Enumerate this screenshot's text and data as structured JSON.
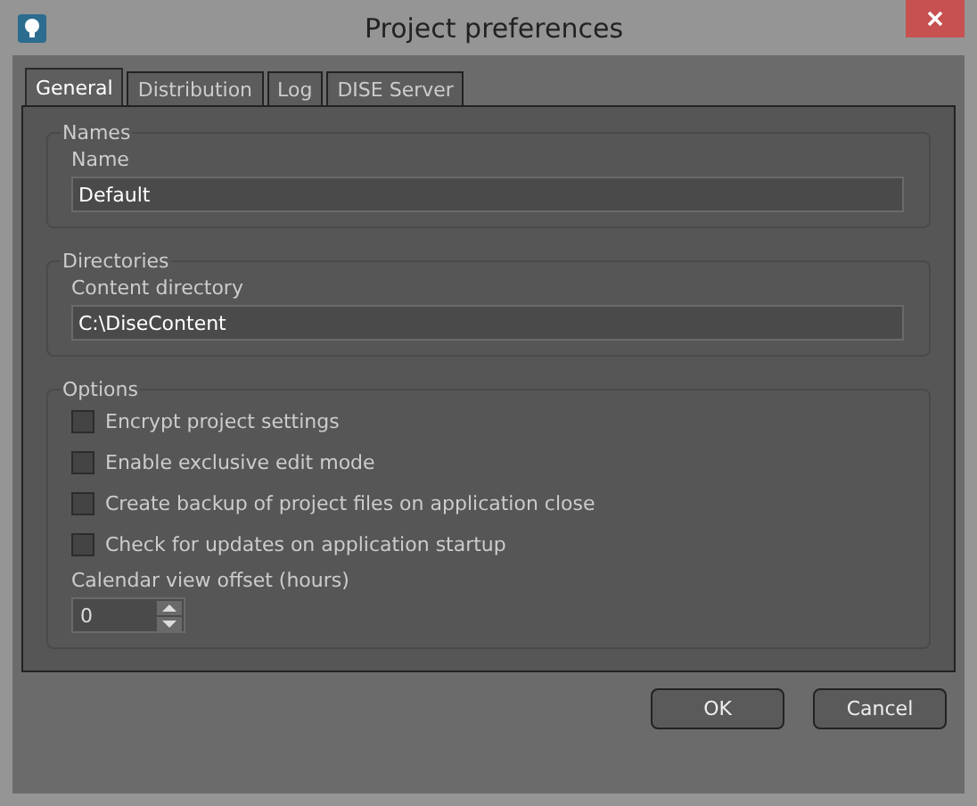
{
  "window": {
    "title": "Project preferences"
  },
  "tabs": [
    {
      "label": "General",
      "selected": true
    },
    {
      "label": "Distribution",
      "selected": false
    },
    {
      "label": "Log",
      "selected": false
    },
    {
      "label": "DISE Server",
      "selected": false
    }
  ],
  "groups": [
    {
      "title": "Names",
      "fields": [
        {
          "label": "Name",
          "value": "Default"
        }
      ]
    },
    {
      "title": "Directories",
      "fields": [
        {
          "label": "Content directory",
          "value": "C:\\DiseContent"
        }
      ]
    }
  ],
  "options": {
    "title": "Options",
    "checkboxes": [
      {
        "label": "Encrypt project settings",
        "checked": false
      },
      {
        "label": "Enable exclusive edit mode",
        "checked": false
      },
      {
        "label": "Create backup of project files on application close",
        "checked": false
      },
      {
        "label": "Check for updates on application startup",
        "checked": false
      }
    ],
    "spinner": {
      "label": "Calendar view offset (hours)",
      "value": "0"
    }
  },
  "buttons": [
    "OK",
    "Cancel"
  ]
}
